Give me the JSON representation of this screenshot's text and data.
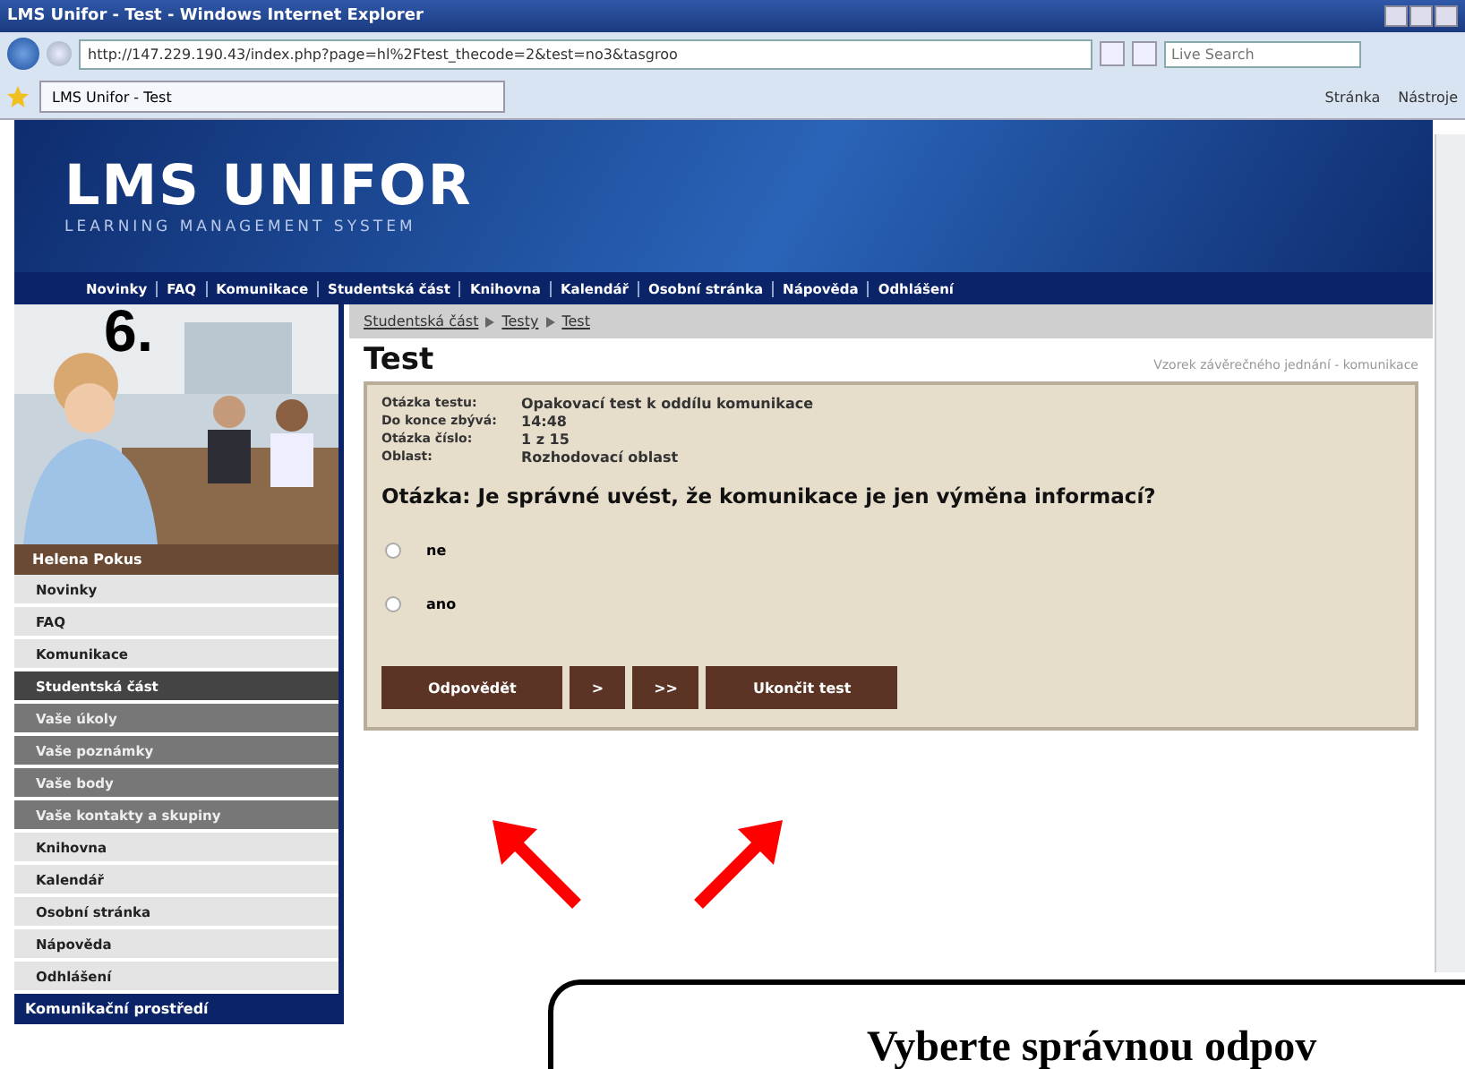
{
  "browser": {
    "title": "LMS Unifor - Test - Windows Internet Explorer",
    "address": "http://147.229.190.43/index.php?page=hl%2Ftest_thecode=2&test=no3&tasgroo",
    "search": {
      "placeholder": "Live Search"
    },
    "tab": "LMS Unifor - Test",
    "toolbar": [
      "Stránka",
      "Nástroje"
    ]
  },
  "header": {
    "logo": "LMS UNIFOR",
    "tagline": "LEARNING MANAGEMENT SYSTEM"
  },
  "nav": [
    "Novinky",
    "FAQ",
    "Komunikace",
    "Studentská část",
    "Knihovna",
    "Kalendář",
    "Osobní stránka",
    "Nápověda",
    "Odhlášení"
  ],
  "sidebar": {
    "user": "Helena Pokus",
    "items": [
      {
        "label": "Novinky",
        "kind": "main",
        "selected": false
      },
      {
        "label": "FAQ",
        "kind": "main",
        "selected": false
      },
      {
        "label": "Komunikace",
        "kind": "main",
        "selected": false
      },
      {
        "label": "Studentská část",
        "kind": "main",
        "selected": true
      },
      {
        "label": "Vaše úkoly",
        "kind": "sub",
        "selected": false
      },
      {
        "label": "Vaše poznámky",
        "kind": "sub",
        "selected": false
      },
      {
        "label": "Vaše body",
        "kind": "sub",
        "selected": false
      },
      {
        "label": "Vaše kontakty a skupiny",
        "kind": "sub",
        "selected": false
      },
      {
        "label": "Knihovna",
        "kind": "main",
        "selected": false
      },
      {
        "label": "Kalendář",
        "kind": "main",
        "selected": false
      },
      {
        "label": "Osobní stránka",
        "kind": "main",
        "selected": false
      },
      {
        "label": "Nápověda",
        "kind": "main",
        "selected": false
      },
      {
        "label": "Odhlášení",
        "kind": "main",
        "selected": false
      }
    ],
    "footer": "Komunikační prostředí"
  },
  "breadcrumb": [
    "Studentská část",
    "Testy",
    "Test"
  ],
  "page_title": "Test",
  "context": "Vzorek závěrečného jednání - komunikace",
  "info": [
    {
      "label": "Otázka testu:",
      "value": "Opakovací test k oddílu komunikace"
    },
    {
      "label": "Do konce zbývá:",
      "value": "14:48"
    },
    {
      "label": "Otázka číslo:",
      "value": "1 z 15"
    },
    {
      "label": "Oblast:",
      "value": "Rozhodovací oblast"
    }
  ],
  "question": "Otázka: Je správné uvést, že komunikace je jen výměna informací?",
  "options": [
    {
      "label": "ne",
      "selected": false
    },
    {
      "label": "ano",
      "selected": false
    }
  ],
  "buttons": [
    "Odpovědět",
    ">",
    ">>",
    "Ukončit test"
  ],
  "overlay": {
    "step": "6.",
    "callout": "Vyberte správnou odpov"
  }
}
